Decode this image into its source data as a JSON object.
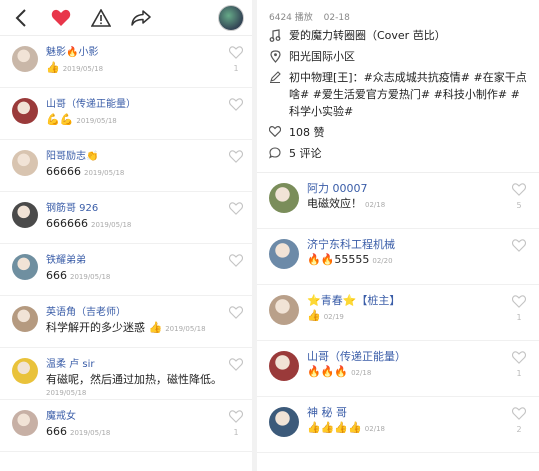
{
  "left": {
    "comments": [
      {
        "name": "魅影🔥小影",
        "text": "👍",
        "date": "2019/05/18",
        "likes": "1",
        "inline_date": true
      },
      {
        "name": "山哥（传递正能量）",
        "text": "💪💪",
        "date": "2019/05/18",
        "likes": "",
        "inline_date": true
      },
      {
        "name": "阳哥励志👏",
        "text": "66666",
        "date": "2019/05/18",
        "likes": "",
        "inline_date": true
      },
      {
        "name": "钢筋哥 926",
        "text": "666666",
        "date": "2019/05/18",
        "likes": "",
        "inline_date": true
      },
      {
        "name": "铁耀弟弟",
        "text": "666",
        "date": "2019/05/18",
        "likes": "",
        "inline_date": true
      },
      {
        "name": "英语角（吉老师）",
        "text": "科学解开的多少迷惑 👍",
        "date": "2019/05/18",
        "likes": "",
        "inline_date": true
      },
      {
        "name": "温柔 卢 sir",
        "text": "有磁呢，然后通过加热，磁性降低。",
        "date": "2019/05/18",
        "likes": "",
        "inline_date": false
      },
      {
        "name": "魔戒女",
        "text": "666",
        "date": "2019/05/18",
        "likes": "1",
        "inline_date": true
      }
    ]
  },
  "right": {
    "plays": "6424 播放",
    "date": "02-18",
    "music": "爱的魔力转圈圈（Cover 芭比）",
    "location": "阳光国际小区",
    "description": "初中物理[王]：#众志成城共抗疫情# #在家干点啥# #爱生活爱官方爱热门# #科技小制作# #科学小实验#",
    "likes": "108 赞",
    "comments_count": "5 评论",
    "comments": [
      {
        "name": "阿力 00007",
        "text": "电磁效应！",
        "date": "02/18",
        "likes": "5"
      },
      {
        "name": "济宁东科工程机械",
        "text": "🔥🔥55555",
        "date": "02/20",
        "likes": ""
      },
      {
        "name": "⭐青春⭐【桩主】",
        "text": "👍",
        "date": "02/19",
        "likes": "1"
      },
      {
        "name": "山哥（传递正能量）",
        "text": "🔥🔥🔥",
        "date": "02/18",
        "likes": "1"
      },
      {
        "name": "神 秘 哥",
        "text": "👍👍👍👍",
        "date": "02/18",
        "likes": "2"
      }
    ]
  },
  "colors": {
    "heart": "#e8364a",
    "link": "#3a5da8"
  }
}
